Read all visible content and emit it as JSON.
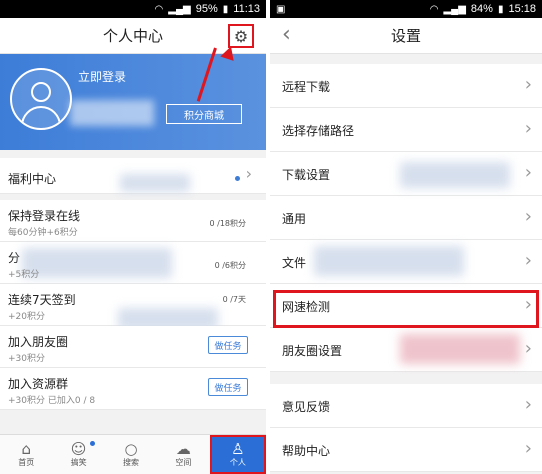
{
  "left": {
    "status": {
      "battery": "95%",
      "time": "11:13"
    },
    "title": "个人中心",
    "login_label": "立即登录",
    "points_mall": "积分商城",
    "items": [
      {
        "title": "福利中心",
        "sub": "",
        "progress": "",
        "action": ""
      },
      {
        "title": "保持登录在线",
        "sub": "每60分钟+6积分",
        "progress": "0 /18积分",
        "action": ""
      },
      {
        "title": "分",
        "sub": "+5积分",
        "progress": "0 /6积分",
        "action": ""
      },
      {
        "title": "连续7天签到",
        "sub": "+20积分",
        "progress": "0 /7天",
        "action": ""
      },
      {
        "title": "加入朋友圈",
        "sub": "+30积分",
        "progress": "",
        "action": "做任务"
      },
      {
        "title": "加入资源群",
        "sub": "+30积分 已加入0 / 8",
        "progress": "",
        "action": "做任务"
      }
    ],
    "tabs": [
      {
        "label": "首页",
        "icon": "home-icon"
      },
      {
        "label": "搞笑",
        "icon": "smile-icon"
      },
      {
        "label": "搜索",
        "icon": "search-icon"
      },
      {
        "label": "空间",
        "icon": "cloud-icon"
      },
      {
        "label": "个人",
        "icon": "person-icon"
      }
    ]
  },
  "right": {
    "status": {
      "battery": "84%",
      "time": "15:18"
    },
    "title": "设置",
    "group1": [
      "远程下载",
      "选择存储路径",
      "下载设置",
      "通用",
      "文件",
      "网速检测",
      "朋友圈设置"
    ],
    "group2": [
      "意见反馈",
      "帮助中心"
    ]
  },
  "colors": {
    "accent": "#3d7dd8",
    "highlight": "#e0161f"
  }
}
